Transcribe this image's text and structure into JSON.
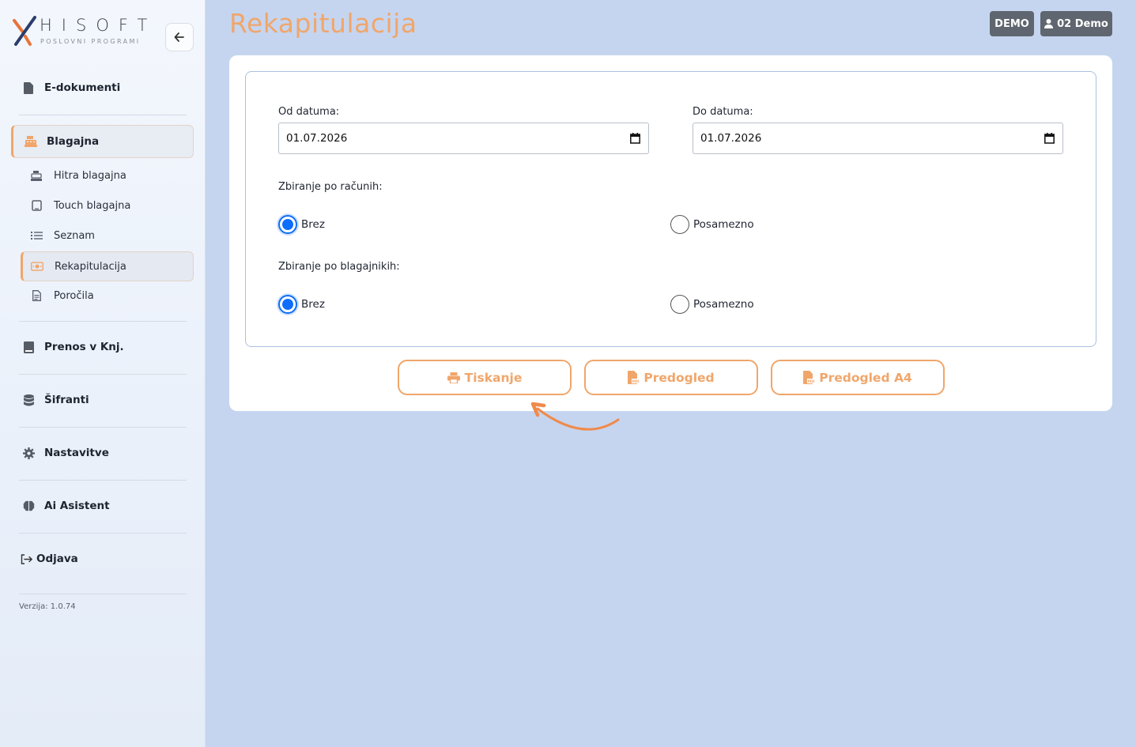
{
  "brand": {
    "name": "HISOFT",
    "tagline": "POSLOVNI PROGRAMI"
  },
  "colors": {
    "accent": "#f0a66b",
    "radio": "#0d6efd",
    "badge": "#5f6670",
    "background": "#c5d5ef"
  },
  "sidebar": {
    "collapse_icon": "arrow-left-icon",
    "items": [
      {
        "label": "E-dokumenti",
        "icon": "file-icon"
      },
      {
        "label": "Blagajna",
        "icon": "cash-register-icon"
      },
      {
        "label": "Prenos v Knj.",
        "icon": "book-icon"
      },
      {
        "label": "Šifranti",
        "icon": "database-icon"
      },
      {
        "label": "Nastavitve",
        "icon": "gear-icon"
      },
      {
        "label": "Ai Asistent",
        "icon": "brain-icon"
      },
      {
        "label": "Odjava",
        "icon": "logout-icon"
      }
    ],
    "subitems": [
      {
        "label": "Hitra blagajna",
        "icon": "register-icon"
      },
      {
        "label": "Touch blagajna",
        "icon": "tablet-icon"
      },
      {
        "label": "Seznam",
        "icon": "list-icon"
      },
      {
        "label": "Rekapitulacija",
        "icon": "money-bill-icon"
      },
      {
        "label": "Poročila",
        "icon": "report-icon"
      }
    ],
    "version": "Verzija: 1.0.74"
  },
  "header": {
    "title": "Rekapitulacija",
    "demo_badge": "DEMO",
    "user": "02 Demo"
  },
  "form": {
    "from_label": "Od datuma:",
    "from_value": "01.07.2026",
    "to_label": "Do datuma:",
    "to_value": "01.07.2026",
    "group_invoices_label": "Zbiranje po računih:",
    "group_cashiers_label": "Zbiranje po blagajnikih:",
    "option_none": "Brez",
    "option_single": "Posamezno",
    "group_invoices_selected": "Brez",
    "group_cashiers_selected": "Brez"
  },
  "actions": {
    "print": "Tiskanje",
    "preview": "Predogled",
    "preview_a4": "Predogled A4"
  }
}
